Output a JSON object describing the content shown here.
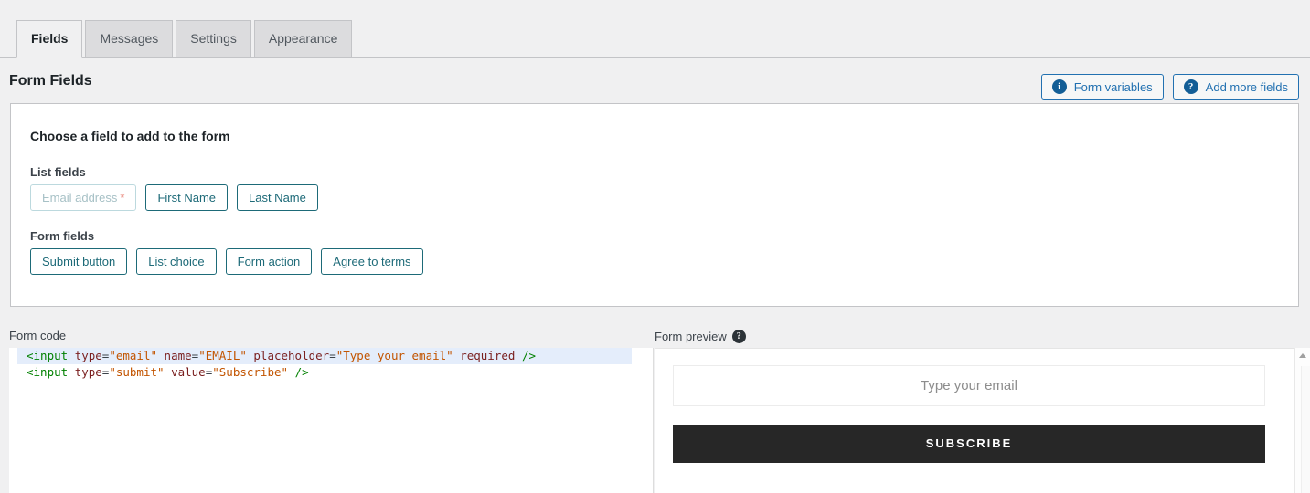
{
  "tabs": [
    {
      "label": "Fields",
      "active": true
    },
    {
      "label": "Messages",
      "active": false
    },
    {
      "label": "Settings",
      "active": false
    },
    {
      "label": "Appearance",
      "active": false
    }
  ],
  "header": {
    "title": "Form Fields",
    "buttons": [
      {
        "label": "Form variables",
        "icon": "info-icon",
        "glyph": "i"
      },
      {
        "label": "Add more fields",
        "icon": "help-icon",
        "glyph": "?"
      }
    ]
  },
  "card": {
    "title": "Choose a field to add to the form",
    "groups": [
      {
        "label": "List fields",
        "buttons": [
          {
            "label": "Email address",
            "required": true,
            "disabled": true,
            "required_marker": "*"
          },
          {
            "label": "First Name",
            "required": false,
            "disabled": false
          },
          {
            "label": "Last Name",
            "required": false,
            "disabled": false
          }
        ]
      },
      {
        "label": "Form fields",
        "buttons": [
          {
            "label": "Submit button",
            "required": false,
            "disabled": false
          },
          {
            "label": "List choice",
            "required": false,
            "disabled": false
          },
          {
            "label": "Form action",
            "required": false,
            "disabled": false
          },
          {
            "label": "Agree to terms",
            "required": false,
            "disabled": false
          }
        ]
      }
    ]
  },
  "form_code": {
    "label": "Form code",
    "lines": [
      {
        "active": true,
        "tokens": [
          {
            "t": "tag",
            "v": "<input"
          },
          {
            "t": "plain",
            "v": " "
          },
          {
            "t": "attr",
            "v": "type"
          },
          {
            "t": "eq",
            "v": "="
          },
          {
            "t": "str",
            "v": "\"email\""
          },
          {
            "t": "plain",
            "v": " "
          },
          {
            "t": "attr",
            "v": "name"
          },
          {
            "t": "eq",
            "v": "="
          },
          {
            "t": "str",
            "v": "\"EMAIL\""
          },
          {
            "t": "plain",
            "v": " "
          },
          {
            "t": "attr",
            "v": "placeholder"
          },
          {
            "t": "eq",
            "v": "="
          },
          {
            "t": "str",
            "v": "\"Type your email\""
          },
          {
            "t": "plain",
            "v": " "
          },
          {
            "t": "attr",
            "v": "required"
          },
          {
            "t": "plain",
            "v": " "
          },
          {
            "t": "tag",
            "v": "/>"
          }
        ]
      },
      {
        "active": false,
        "tokens": [
          {
            "t": "tag",
            "v": "<input"
          },
          {
            "t": "plain",
            "v": " "
          },
          {
            "t": "attr",
            "v": "type"
          },
          {
            "t": "eq",
            "v": "="
          },
          {
            "t": "str",
            "v": "\"submit\""
          },
          {
            "t": "plain",
            "v": " "
          },
          {
            "t": "attr",
            "v": "value"
          },
          {
            "t": "eq",
            "v": "="
          },
          {
            "t": "str",
            "v": "\"Subscribe\""
          },
          {
            "t": "plain",
            "v": " "
          },
          {
            "t": "tag",
            "v": "/>"
          }
        ]
      }
    ]
  },
  "form_preview": {
    "label": "Form preview",
    "help_glyph": "?",
    "email_placeholder": "Type your email",
    "submit_label": "SUBSCRIBE"
  },
  "colors": {
    "page_bg": "#f0f0f1",
    "accent_blue": "#2271b1",
    "teal": "#1d6a78",
    "required_star": "#e8867a",
    "submit_bg": "#272727",
    "code_active_line": "#e4edfb"
  }
}
